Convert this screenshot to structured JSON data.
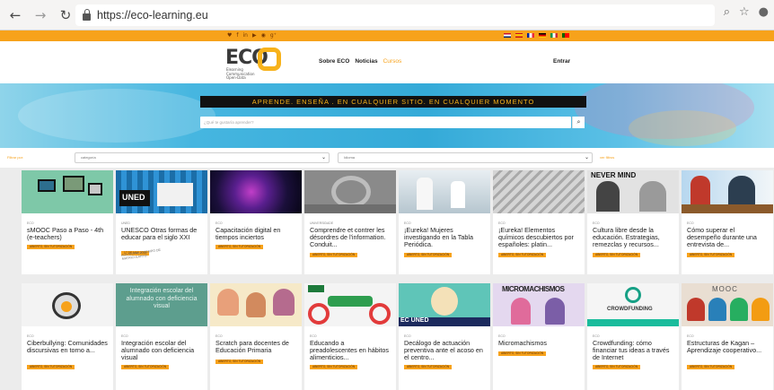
{
  "browser": {
    "url": "https://eco-learning.eu",
    "back_icon": "arrow-left-icon",
    "forward_icon": "arrow-right-icon",
    "reload_icon": "reload-icon"
  },
  "topbar": {
    "social_icons": [
      "twitter-icon",
      "facebook-icon",
      "linkedin-icon",
      "youtube-icon",
      "rss-icon",
      "google-plus-icon"
    ],
    "languages": [
      "en",
      "es",
      "fr",
      "de",
      "it",
      "pt"
    ]
  },
  "header": {
    "logo_text": "ECO",
    "logo_sub": "Elearning Communication Open-Data",
    "nav": [
      "Sobre ECO",
      "Noticias",
      "Cursos"
    ],
    "active_nav": "Cursos",
    "login": "Entrar"
  },
  "hero": {
    "tagline": "APRENDE. ENSEÑA . EN CUALQUIER SITIO. EN CUALQUIER MOMENTO",
    "search_placeholder": "¿Qué te gustaría aprender?"
  },
  "filters": {
    "left_label": "Filtrar por:",
    "category_placeholder": "categoría",
    "idioma_placeholder": "Idioma",
    "right_label": "ver filtros"
  },
  "courses": [
    {
      "kind": "ECO",
      "title": "sMOOC Paso a Paso - 4th (e-teachers)",
      "badge": "ABIERTO, SIN TUTORIZACIÓN"
    },
    {
      "kind": "UNED",
      "title": "UNESCO Otras formas de educar para el siglo XXI",
      "badge": "17 DE MAY 2019",
      "stamp": "AÚN ESTÁS A TIEMPO DE MATRICULARTE!"
    },
    {
      "kind": "ECO",
      "title": "Capacitación digital en tiempos inciertos",
      "badge": "ABIERTO, SIN TUTORIZACIÓN"
    },
    {
      "kind": "UNIVERSIDADE",
      "title": "Comprendre et contrer les désordres de l'information. Conduit...",
      "badge": "ABIERTO, SIN TUTORIZACIÓN"
    },
    {
      "kind": "ECO",
      "title": "¡Eureka! Mujeres investigando en la Tabla Periódica.",
      "badge": "ABIERTO, SIN TUTORIZACIÓN"
    },
    {
      "kind": "ECO",
      "title": "¡Eureka! Elementos químicos descubiertos por españoles: platin...",
      "badge": "ABIERTO, SIN TUTORIZACIÓN"
    },
    {
      "kind": "ECO",
      "title": "Cultura libre desde la educación. Estrategias, remezclas y recursos...",
      "badge": "ABIERTO, SIN TUTORIZACIÓN"
    },
    {
      "kind": "ECO",
      "title": "Cómo superar el desempeño durante una entrevista de...",
      "badge": "ABIERTO, SIN TUTORIZACIÓN"
    },
    {
      "kind": "ECO",
      "title": "Ciberbullying: Comunidades discursivas en torno a...",
      "badge": "ABIERTO, SIN TUTORIZACIÓN"
    },
    {
      "kind": "ECO",
      "title": "Integración escolar del alumnado con deficiencia visual",
      "badge": "ABIERTO, SIN TUTORIZACIÓN"
    },
    {
      "kind": "ECO",
      "title": "Scratch para docentes de Educación Primaria",
      "badge": "ABIERTO, SIN TUTORIZACIÓN"
    },
    {
      "kind": "ECO",
      "title": "Educando a preadolescentes en hábitos alimenticios...",
      "badge": "ABIERTO, SIN TUTORIZACIÓN"
    },
    {
      "kind": "ECO",
      "title": "Decálogo de actuación preventiva ante el acoso en el centro...",
      "badge": "ABIERTO, SIN TUTORIZACIÓN"
    },
    {
      "kind": "ECO",
      "title": "Micromachismos",
      "badge": "ABIERTO, SIN TUTORIZACIÓN"
    },
    {
      "kind": "ECO",
      "title": "Crowdfunding: cómo financiar tus ideas a través de Internet",
      "badge": "ABIERTO, SIN TUTORIZACIÓN"
    },
    {
      "kind": "ECO",
      "title": "Estructuras de Kagan – Aprendizaje cooperativo...",
      "badge": "ABIERTO, SIN TUTORIZACIÓN"
    }
  ],
  "image_text": {
    "uned": "UNED",
    "integracion": "Integración escolar del alumnado con deficiencia visual",
    "micromachismos": "MICROMACHISMOS",
    "crowdfunding": "CROWDFUNDING",
    "mooc": "MOOC",
    "never_mind": "NEVER MIND",
    "eco_uned": "EC UNED"
  },
  "colors": {
    "accent": "#f7a21b",
    "hero": "#34aad8",
    "tagline_bg": "#111111"
  }
}
